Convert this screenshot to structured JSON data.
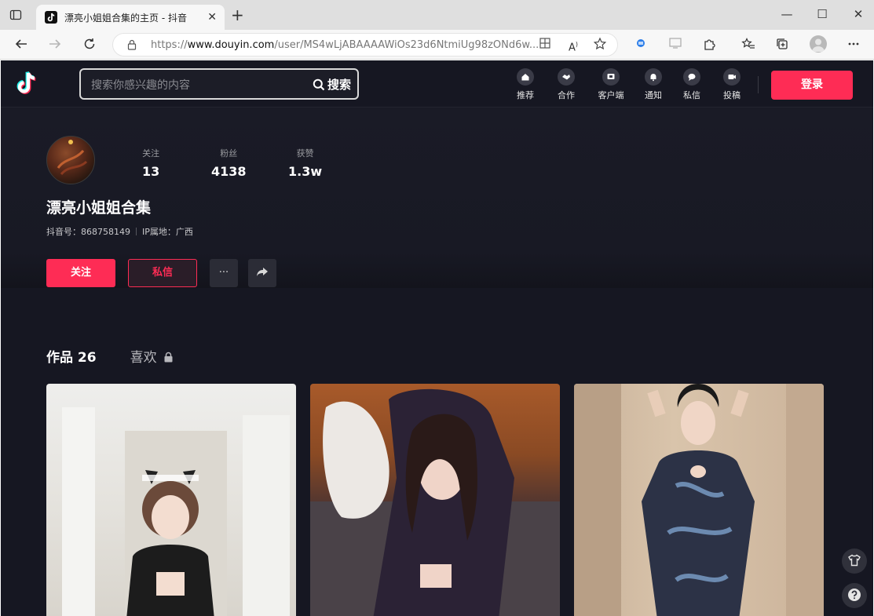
{
  "browser": {
    "tab_title": "漂亮小姐姐合集的主页 - 抖音",
    "tab_close": "✕",
    "new_tab": "+",
    "url_prefix": "https://",
    "url_host": "www.douyin.com",
    "url_path": "/user/MS4wLjABAAAAWiOs23d6NtmiUg98zONd6w...",
    "window_minimize": "—",
    "window_maximize": "☐",
    "window_close": "✕"
  },
  "header": {
    "search_placeholder": "搜索你感兴趣的内容",
    "search_button": "搜索",
    "nav": [
      {
        "label": "推荐",
        "icon": "home-icon"
      },
      {
        "label": "合作",
        "icon": "handshake-icon"
      },
      {
        "label": "客户端",
        "icon": "monitor-icon"
      },
      {
        "label": "通知",
        "icon": "bell-icon"
      },
      {
        "label": "私信",
        "icon": "chat-icon"
      },
      {
        "label": "投稿",
        "icon": "video-upload-icon"
      }
    ],
    "login": "登录"
  },
  "profile": {
    "name": "漂亮小姐姐合集",
    "stats": [
      {
        "label": "关注",
        "value": "13"
      },
      {
        "label": "粉丝",
        "value": "4138"
      },
      {
        "label": "获赞",
        "value": "1.3w"
      }
    ],
    "douyin_id_label": "抖音号：",
    "douyin_id": "868758149",
    "ip_location": "IP属地：广西",
    "follow_button": "关注",
    "message_button": "私信",
    "more_button": "···"
  },
  "content_tabs": {
    "works": "作品 26",
    "likes": "喜欢"
  },
  "videos": [
    {
      "theme": "maid-outfit"
    },
    {
      "theme": "black-dress"
    },
    {
      "theme": "qipao"
    }
  ],
  "colors": {
    "accent": "#fe2c55",
    "page_bg": "#161722"
  }
}
